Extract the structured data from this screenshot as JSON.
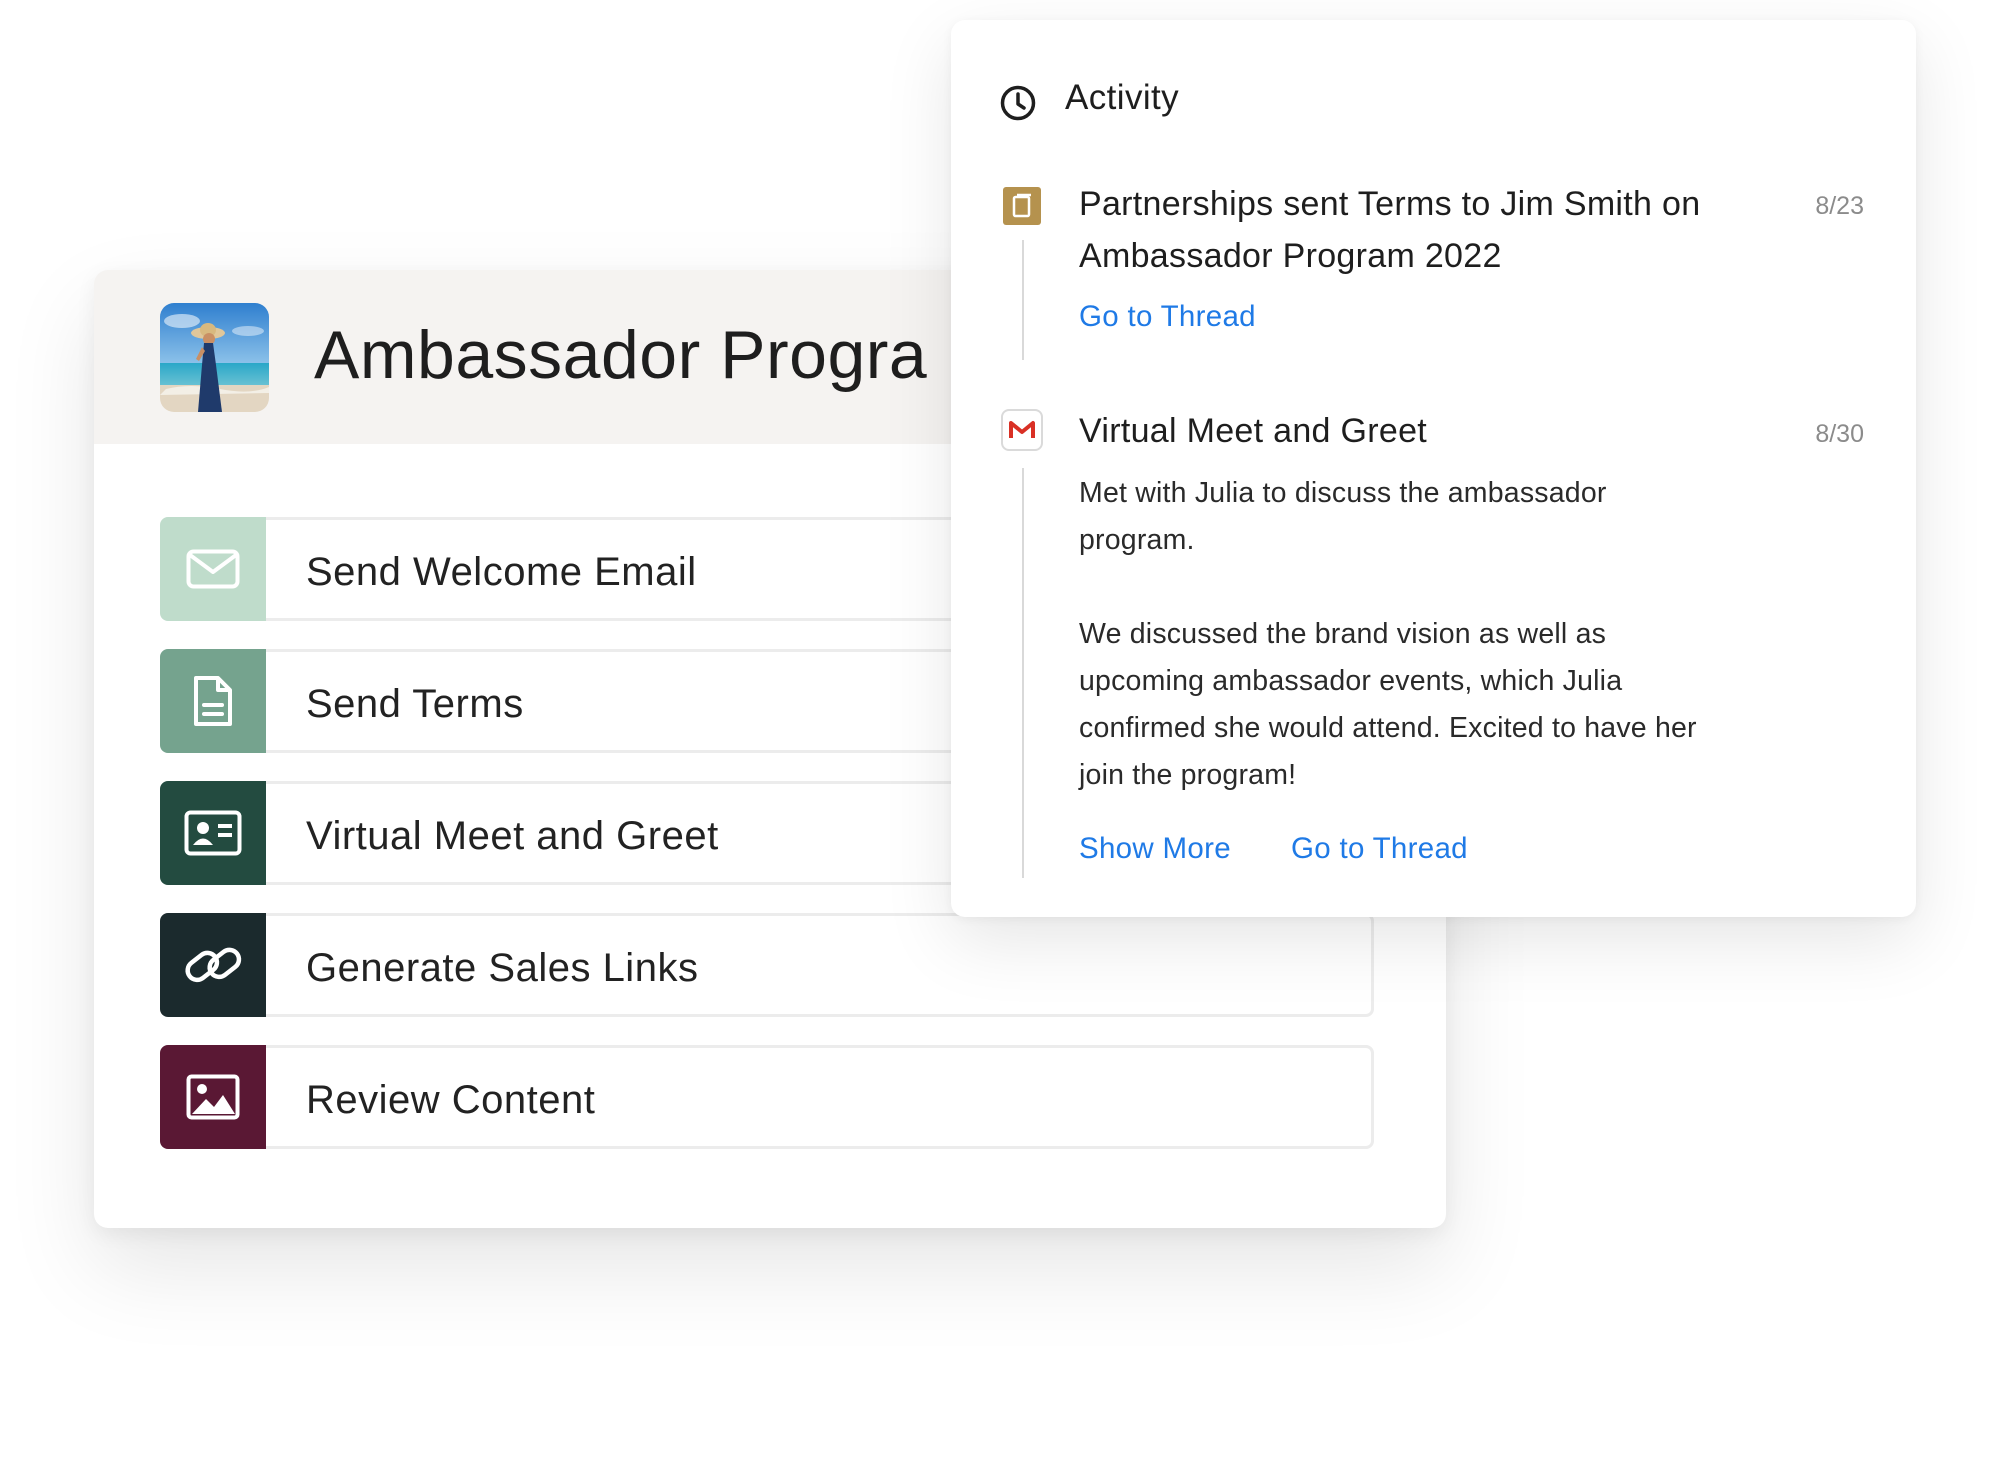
{
  "program": {
    "title": "Ambassador Progra",
    "avatar_icon": "beach-photo-avatar",
    "tasks": [
      {
        "label": "Send Welcome Email",
        "icon": "envelope-icon",
        "color": "#bfdccb"
      },
      {
        "label": "Send Terms",
        "icon": "document-icon",
        "color": "#75a38e"
      },
      {
        "label": "Virtual Meet and Greet",
        "icon": "id-card-icon",
        "color": "#234b40"
      },
      {
        "label": "Generate Sales Links",
        "icon": "link-icon",
        "color": "#1b2a2d"
      },
      {
        "label": "Review Content",
        "icon": "image-icon",
        "color": "#5a1834"
      }
    ]
  },
  "activity": {
    "title": "Activity",
    "header_icon": "clock-icon",
    "entries": [
      {
        "icon": "document-badge-icon",
        "icon_color": "#b5924e",
        "title": "Partnerships sent Terms to Jim Smith on Ambassador Program 2022",
        "date": "8/23",
        "link": "Go to Thread"
      },
      {
        "icon": "gmail-icon",
        "icon_color": "#d93025",
        "title": "Virtual Meet and Greet",
        "date": "8/30",
        "body_1": "Met with Julia to discuss the ambassador program.",
        "body_2": "We discussed the brand vision as well as upcoming ambassador events, which Julia confirmed she would attend. Excited to have her join the program!",
        "show_more": "Show More",
        "link": "Go to Thread"
      }
    ]
  },
  "colors": {
    "link": "#1f7ae6",
    "header_bg": "#f5f3f1"
  }
}
